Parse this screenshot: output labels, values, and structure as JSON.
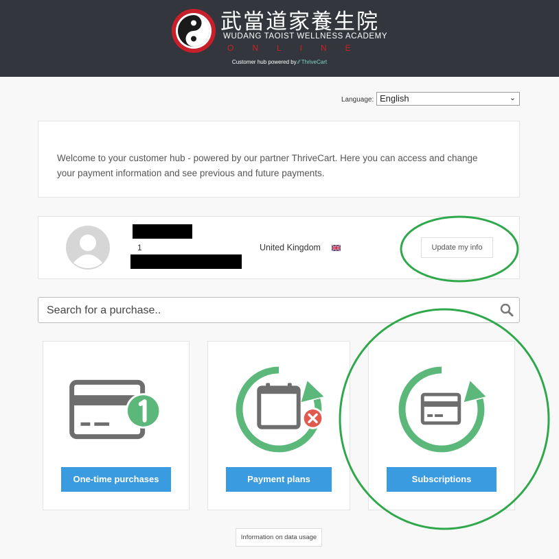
{
  "header": {
    "logo_chinese": "武當道家養生院",
    "logo_english": "WUDANG TAOIST WELLNESS ACADEMY",
    "logo_online": "ONLINE",
    "powered_prefix": "Customer hub powered by",
    "powered_brand": "ThriveCart"
  },
  "language": {
    "label": "Language:",
    "selected": "English"
  },
  "welcome": {
    "text": "Welcome to your customer hub - powered by our partner ThriveCart. Here you can access and change your payment information and see previous and future payments."
  },
  "profile": {
    "line2": "1",
    "country": "United Kingdom",
    "update_label": "Update my info"
  },
  "search": {
    "placeholder": "Search for a purchase.."
  },
  "tiles": [
    {
      "label": "One-time purchases",
      "icon": "card-one-icon"
    },
    {
      "label": "Payment plans",
      "icon": "calendar-cancel-icon"
    },
    {
      "label": "Subscriptions",
      "icon": "card-refresh-icon"
    }
  ],
  "footer": {
    "data_usage_label": "Information on data usage"
  },
  "colors": {
    "header_bg": "#33373d",
    "accent_button": "#3a9be0",
    "icon_green": "#5bb87a",
    "icon_gray": "#6e6e6e",
    "annotation_green": "#2ea84a",
    "brand_red": "#d02020"
  }
}
